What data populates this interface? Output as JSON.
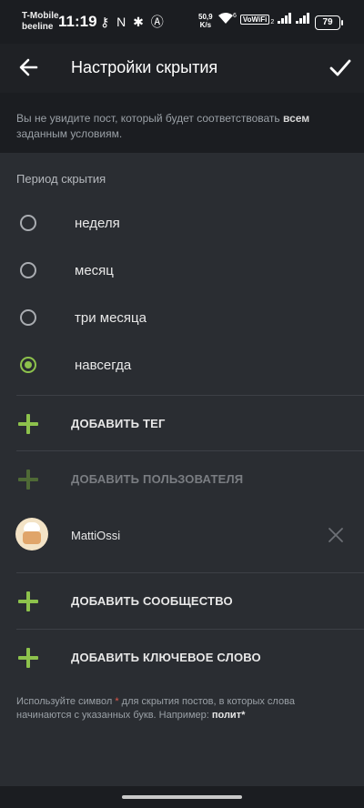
{
  "status_bar": {
    "carrier_1": "T-Mobile",
    "carrier_2": "beeline",
    "time": "11:19",
    "left_icons": "⚷ N ✱ Ⓐ",
    "net_speed_value": "50,9",
    "net_speed_unit": "K/s",
    "wifi_label": "6",
    "vowifi": "VoWiFi",
    "vowifi_sub": "2",
    "battery": "79"
  },
  "app_bar": {
    "title": "Настройки скрытия",
    "back_icon": "arrow-left",
    "confirm_icon": "check"
  },
  "notice": {
    "text_before": "Вы не увидите пост, который будет соответствовать ",
    "text_bold": "всем",
    "text_after": " заданным условиям."
  },
  "period": {
    "label": "Период скрытия",
    "options": [
      {
        "label": "неделя",
        "selected": false
      },
      {
        "label": "месяц",
        "selected": false
      },
      {
        "label": "три месяца",
        "selected": false
      },
      {
        "label": "навсегда",
        "selected": true
      }
    ]
  },
  "actions": {
    "add_tag": "ДОБАВИТЬ ТЕГ",
    "add_user": "ДОБАВИТЬ ПОЛЬЗОВАТЕЛЯ",
    "add_community": "ДОБАВИТЬ СООБЩЕСТВО",
    "add_keyword": "ДОБАВИТЬ КЛЮЧЕВОЕ СЛОВО"
  },
  "users": [
    {
      "name": "MattiOssi"
    }
  ],
  "hint": {
    "part1": "Используйте символ ",
    "star": "*",
    "part2": " для скрытия постов, в которых слова начинаются с указанных букв. Например: ",
    "example": "полит*"
  },
  "colors": {
    "accent": "#8dc24c",
    "background": "#2a2d32",
    "app_bar": "#1f2125",
    "notice_bg": "#1b1d21",
    "star": "#e0584b"
  }
}
